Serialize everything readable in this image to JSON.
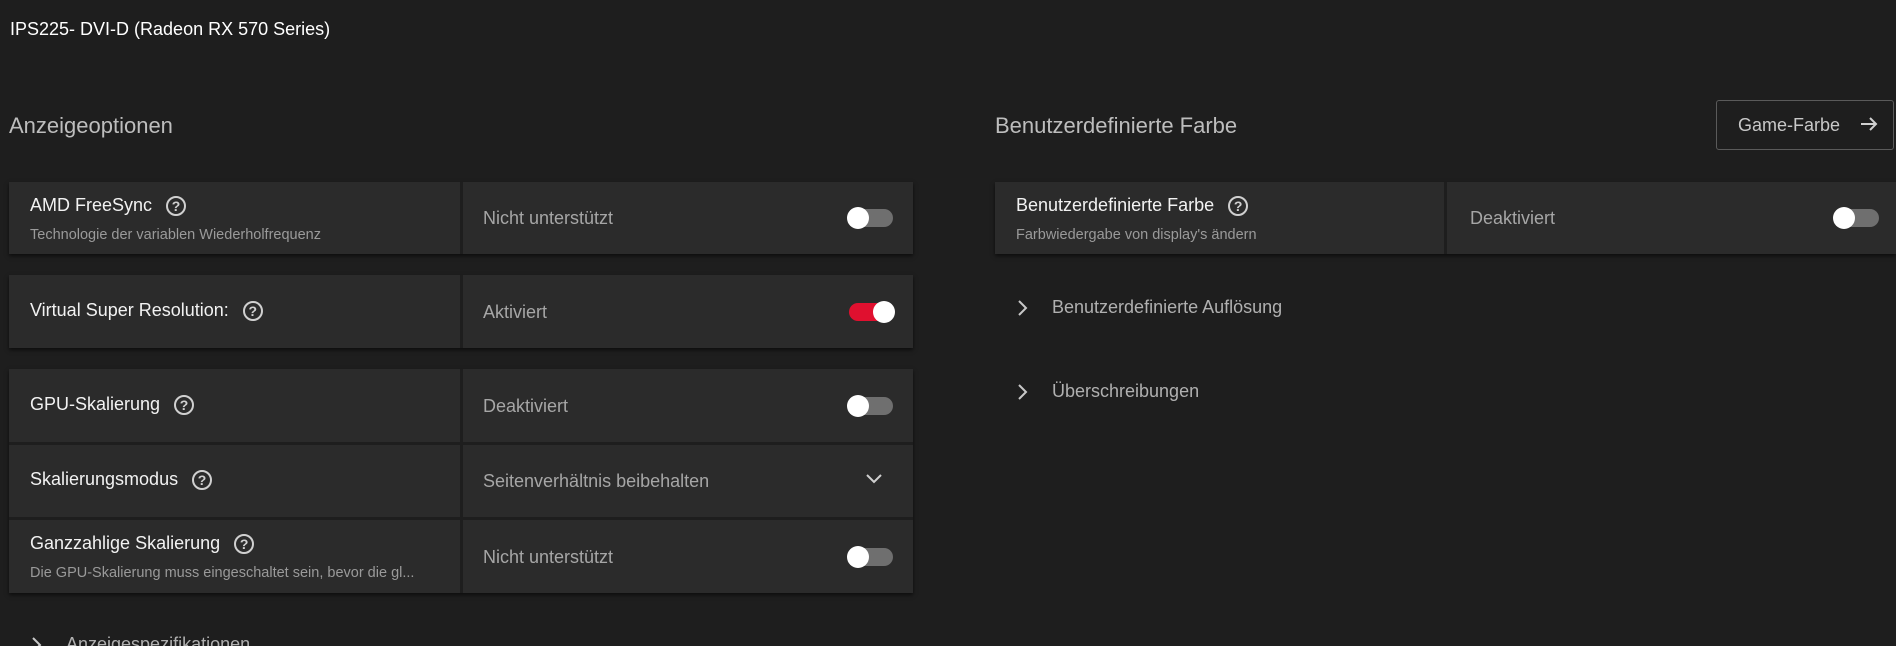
{
  "window": {
    "title": "IPS225- DVI-D (Radeon RX 570 Series)"
  },
  "left_section": {
    "title": "Anzeigeoptionen",
    "rows": [
      {
        "label": "AMD FreeSync",
        "sublabel": "Technologie der variablen Wiederholfrequenz",
        "value": "Nicht unterstützt",
        "control": "toggle",
        "on": false
      },
      {
        "label": "Virtual Super Resolution:",
        "sublabel": "",
        "value": "Aktiviert",
        "control": "toggle",
        "on": true
      },
      {
        "label": "GPU-Skalierung",
        "sublabel": "",
        "value": "Deaktiviert",
        "control": "toggle",
        "on": false
      },
      {
        "label": "Skalierungsmodus",
        "sublabel": "",
        "value": "Seitenverhältnis beibehalten",
        "control": "dropdown"
      },
      {
        "label": "Ganzzahlige Skalierung",
        "sublabel": "Die GPU-Skalierung muss eingeschaltet sein, bevor die gl...",
        "value": "Nicht unterstützt",
        "control": "toggle",
        "on": false
      }
    ],
    "expander": {
      "label": "Anzeigespezifikationen"
    }
  },
  "right_section": {
    "title": "Benutzerdefinierte Farbe",
    "game_button": {
      "label": "Game-Farbe"
    },
    "custom_color_row": {
      "label": "Benutzerdefinierte Farbe",
      "sublabel": "Farbwiedergabe von display's ändern",
      "value": "Deaktiviert",
      "on": false
    },
    "expanders": [
      {
        "label": "Benutzerdefinierte Auflösung"
      },
      {
        "label": "Überschreibungen"
      }
    ]
  },
  "colors": {
    "background": "#1e1e1e",
    "card": "#2b2b2b",
    "accent_red": "#e0102f"
  },
  "icons": {
    "help": "question-circle-icon",
    "chevron_down": "chevron-down-icon",
    "chevron_right": "chevron-right-icon",
    "arrow_right": "arrow-right-icon"
  }
}
